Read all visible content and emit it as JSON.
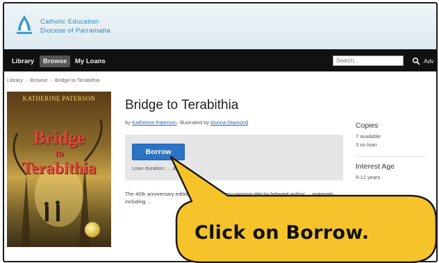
{
  "header": {
    "logo_line1": "Catholic Education",
    "logo_line2": "Diocese of Parramatta"
  },
  "nav": {
    "items": [
      {
        "label": "Library"
      },
      {
        "label": "Browse"
      },
      {
        "label": "My Loans"
      }
    ],
    "active": "Browse",
    "search_placeholder": "Search...",
    "advanced_label": "Adv"
  },
  "breadcrumb": [
    "Library",
    "Browse",
    "Bridge to Terabithia"
  ],
  "book": {
    "cover_author": "KATHERINE PATERSON",
    "cover_title_1": "Bridge",
    "cover_title_2": "to",
    "cover_title_3": "Terabithia",
    "title": "Bridge to Terabithia",
    "by_prefix": "by",
    "author": "Katherine Paterson",
    "illustrated_prefix": ", Illustrated by",
    "illustrator": "Donna Diamond",
    "borrow_label": "Borrow",
    "loan_duration": "Loan duration: ... days",
    "description": "The 40th anniversary edition of the ... Newbery-winning title by beloved author ... materials including ..."
  },
  "sidebar": {
    "copies_heading": "Copies",
    "copies_available": "7 available",
    "copies_on_loan": "3 on loan",
    "interest_heading": "Interest Age",
    "interest_value": "9-12 years"
  },
  "callout": {
    "text": "Click on Borrow.",
    "fill_color": "#f6c42a",
    "stroke_color": "#1a1a1a"
  }
}
